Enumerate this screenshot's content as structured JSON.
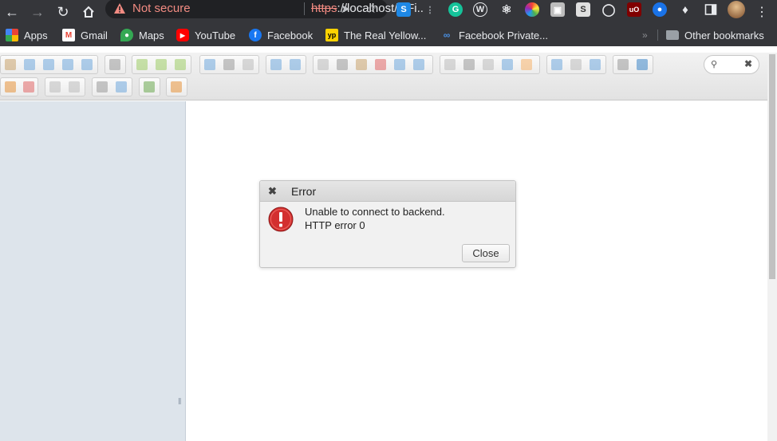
{
  "browser": {
    "security_text": "Not secure",
    "url_scheme": "https",
    "url_rest": "://localhost/elFi...",
    "accent": "#f28b82",
    "extensions": [
      "s-extension-icon",
      "network-extension-icon",
      "grammarly-icon",
      "wordpress-icon",
      "react-devtools-icon",
      "color-picker-icon",
      "screenshot-icon",
      "s-icon",
      "circle-icon",
      "ublock-icon",
      "blue-circle-icon",
      "puzzle-icon"
    ],
    "bookmarks": [
      {
        "label": "Apps",
        "icon": "apps-grid-icon"
      },
      {
        "label": "Gmail",
        "icon": "gmail-icon"
      },
      {
        "label": "Maps",
        "icon": "maps-icon"
      },
      {
        "label": "YouTube",
        "icon": "youtube-icon"
      },
      {
        "label": "Facebook",
        "icon": "facebook-icon"
      },
      {
        "label": "The Real Yellow...",
        "icon": "yellowpages-icon"
      },
      {
        "label": "Facebook Private...",
        "icon": "link-icon"
      }
    ],
    "overflow": "»",
    "other_bookmarks": "Other bookmarks"
  },
  "dialog": {
    "title": "Error",
    "message_line1": "Unable to connect to backend.",
    "message_line2": "HTTP error 0",
    "close_button": "Close"
  }
}
